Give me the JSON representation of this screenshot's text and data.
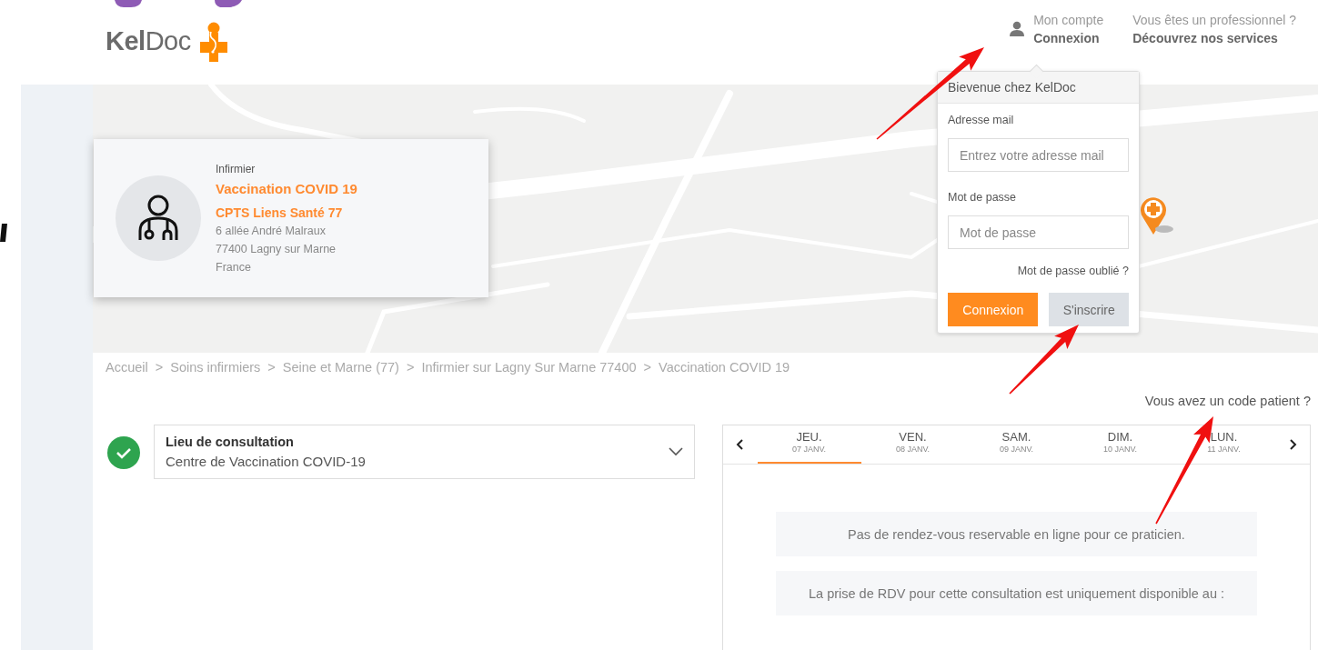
{
  "header": {
    "logo": "**Kel**Doc",
    "account": {
      "line1": "Mon compte",
      "line2": "Connexion"
    },
    "pro": {
      "line1": "Vous êtes un professionnel ?",
      "line2": "Découvrez nos services"
    }
  },
  "login_popup": {
    "title": "Bievenue chez KelDoc",
    "email": {
      "label": "Adresse mail",
      "placeholder": "Entrez votre adresse mail"
    },
    "password": {
      "label": "Mot de passe",
      "placeholder": "Mot de passe"
    },
    "forgot": "Mot de passe oublié ?",
    "buttons": [
      {
        "label": "Connexion",
        "kind": "primary"
      },
      {
        "label": "S'inscrire",
        "kind": "secondary"
      }
    ]
  },
  "practitioner_card": {
    "category": "Infirmier",
    "name": "Vaccination COVID 19",
    "organization": "CPTS Liens Santé 77",
    "address": [
      "6 allée André Malraux",
      "77400 Lagny sur Marne",
      "France"
    ]
  },
  "breadcrumb": {
    "separator": ">",
    "items": [
      "Accueil",
      "Soins infirmiers",
      "Seine et Marne (77)",
      "Infirmier sur Lagny Sur Marne 77400",
      "Vaccination COVID 19"
    ]
  },
  "patient_code_link": "Vous avez un code patient ?",
  "consultation_place": {
    "label": "Lieu de consultation",
    "value": "Centre de Vaccination COVID-19",
    "confirmed": true
  },
  "calendar": {
    "days": [
      {
        "day": "JEU.",
        "date": "07 JANV.",
        "selected": true
      },
      {
        "day": "VEN.",
        "date": "08 JANV.",
        "selected": false
      },
      {
        "day": "SAM.",
        "date": "09 JANV.",
        "selected": false
      },
      {
        "day": "DIM.",
        "date": "10 JANV.",
        "selected": false
      },
      {
        "day": "LUN.",
        "date": "11 JANV.",
        "selected": false
      }
    ],
    "messages": [
      "Pas de rendez-vous reservable en ligne pour ce praticien.",
      "La prise de RDV pour cette consultation est uniquement disponible au :"
    ]
  }
}
